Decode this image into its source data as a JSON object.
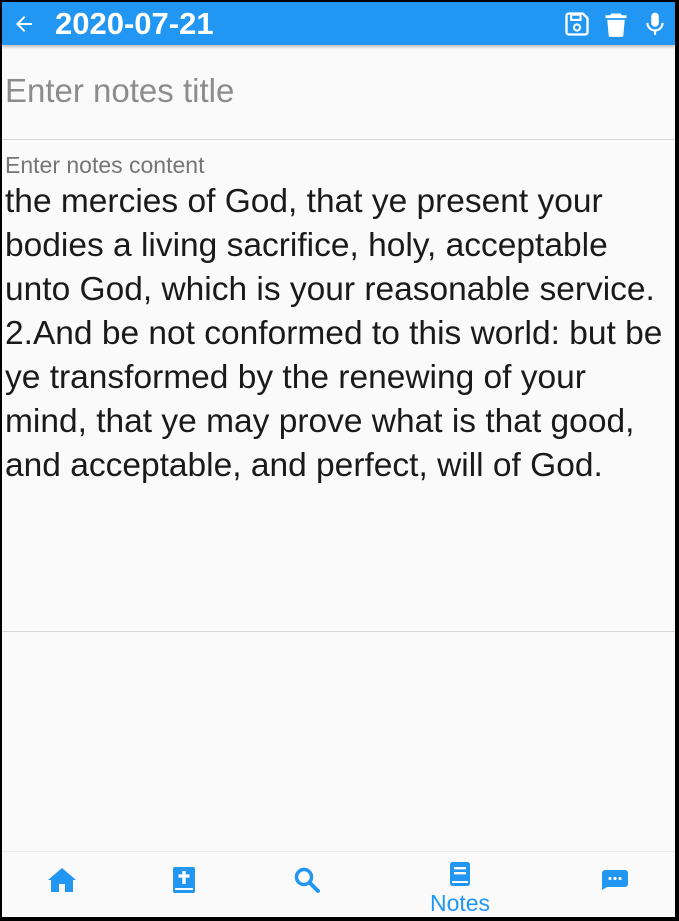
{
  "colors": {
    "accent": "#2196f3",
    "background": "#fafafa"
  },
  "appbar": {
    "back_icon": "arrow-back-icon",
    "title": "2020-07-21",
    "actions": [
      "save-icon",
      "delete-icon",
      "mic-icon"
    ]
  },
  "editor": {
    "title_value": "",
    "title_placeholder": "Enter notes title",
    "content_label": "Enter notes content",
    "content_text": "the mercies of God, that ye present your bodies a living sacrifice, holy, acceptable unto God, which is your reasonable service.\n2.And be not conformed to this world: but be ye transformed by the renewing of your mind, that ye may prove what is that good, and acceptable, and perfect, will of God."
  },
  "bottom_nav": {
    "items": [
      {
        "icon": "home-icon",
        "label": ""
      },
      {
        "icon": "bible-icon",
        "label": ""
      },
      {
        "icon": "search-icon",
        "label": ""
      },
      {
        "icon": "notes-icon",
        "label": "Notes",
        "active": true
      },
      {
        "icon": "message-icon",
        "label": ""
      }
    ]
  }
}
